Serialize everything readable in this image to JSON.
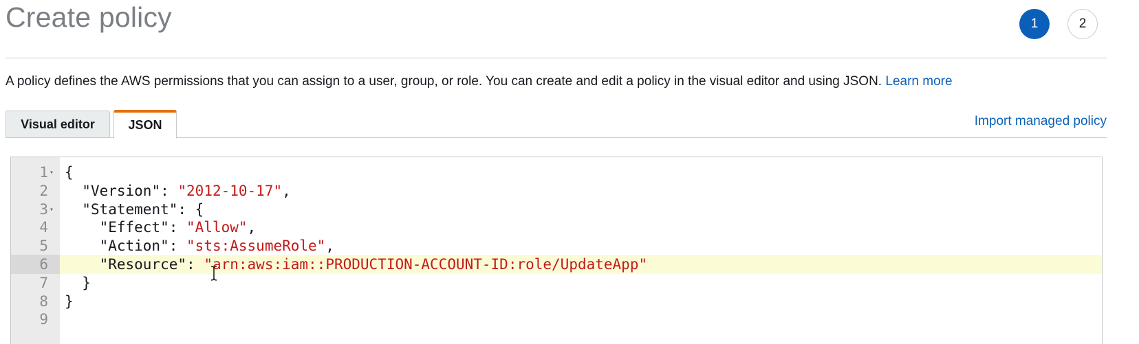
{
  "header": {
    "title": "Create policy",
    "steps": [
      "1",
      "2"
    ]
  },
  "description": {
    "text": "A policy defines the AWS permissions that you can assign to a user, group, or role. You can create and edit a policy in the visual editor and using JSON.",
    "link": "Learn more"
  },
  "tabs": {
    "visual_editor": "Visual editor",
    "json": "JSON",
    "import_link": "Import managed policy"
  },
  "editor": {
    "line_numbers": [
      "1",
      "2",
      "3",
      "4",
      "5",
      "6",
      "7",
      "8",
      "9"
    ],
    "active_line": "6",
    "lines": [
      {
        "indent": "",
        "key": "",
        "sep": "",
        "value": "",
        "tail": "{"
      },
      {
        "indent": "  ",
        "key": "\"Version\"",
        "sep": ": ",
        "value": "\"2012-10-17\"",
        "tail": ","
      },
      {
        "indent": "  ",
        "key": "\"Statement\"",
        "sep": ": ",
        "value": "",
        "tail": "{"
      },
      {
        "indent": "    ",
        "key": "\"Effect\"",
        "sep": ": ",
        "value": "\"Allow\"",
        "tail": ","
      },
      {
        "indent": "    ",
        "key": "\"Action\"",
        "sep": ": ",
        "value": "\"sts:AssumeRole\"",
        "tail": ","
      },
      {
        "indent": "    ",
        "key": "\"Resource\"",
        "sep": ": ",
        "value": "\"arn:aws:iam::PRODUCTION-ACCOUNT-ID:role/UpdateApp\"",
        "tail": ""
      },
      {
        "indent": "  ",
        "key": "",
        "sep": "",
        "value": "",
        "tail": "}"
      },
      {
        "indent": "",
        "key": "",
        "sep": "",
        "value": "",
        "tail": "}"
      },
      {
        "indent": "",
        "key": "",
        "sep": "",
        "value": "",
        "tail": ""
      }
    ]
  },
  "colors": {
    "accent_blue": "#0b5fb8",
    "tab_accent": "#e5700a",
    "string_red": "#c41a1a",
    "active_line": "#fbfbd6"
  }
}
